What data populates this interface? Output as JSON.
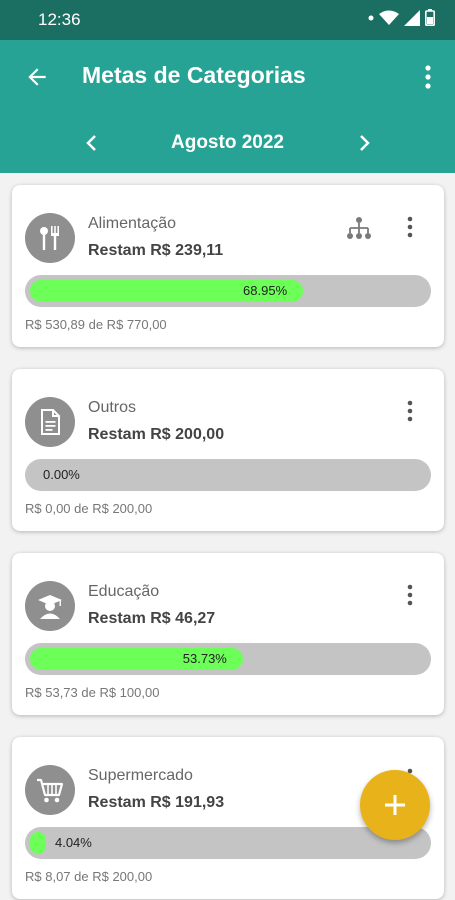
{
  "status_bar": {
    "time": "12:36"
  },
  "app_bar": {
    "title": "Metas de Categorias"
  },
  "month_selector": {
    "label": "Agosto 2022"
  },
  "colors": {
    "status_bar": "#1b6f62",
    "app_bar": "#26a395",
    "progress_fill": "#6bff57",
    "progress_track": "#c4c4c4",
    "fab": "#e8b31a"
  },
  "goals": [
    {
      "name": "Alimentação",
      "remaining": "Restam R$ 239,11",
      "percent_label": "68.95%",
      "progress": 0.6895,
      "detail": "R$ 530,89 de R$ 770,00",
      "icon": "fork-knife-icon",
      "has_subcategories": true
    },
    {
      "name": "Outros",
      "remaining": "Restam R$ 200,00",
      "percent_label": "0.00%",
      "progress": 0.0,
      "detail": "R$ 0,00 de R$ 200,00",
      "icon": "document-icon",
      "has_subcategories": false
    },
    {
      "name": "Educação",
      "remaining": "Restam R$ 46,27",
      "percent_label": "53.73%",
      "progress": 0.5373,
      "detail": "R$ 53,73 de R$ 100,00",
      "icon": "graduate-icon",
      "has_subcategories": false
    },
    {
      "name": "Supermercado",
      "remaining": "Restam R$ 191,93",
      "percent_label": "4.04%",
      "progress": 0.0404,
      "detail": "R$ 8,07 de R$ 200,00",
      "icon": "cart-icon",
      "has_subcategories": false
    }
  ],
  "fab": {
    "icon": "plus-icon"
  }
}
